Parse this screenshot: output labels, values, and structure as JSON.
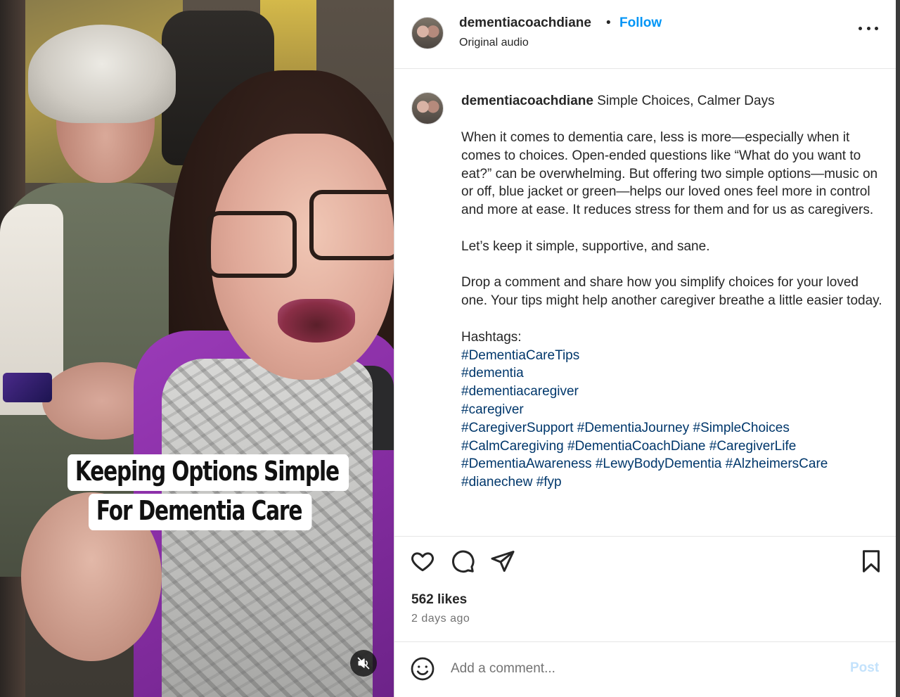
{
  "post": {
    "username": "dementiacoachdiane",
    "separator": "•",
    "follow_label": "Follow",
    "audio_label": "Original audio",
    "more_icon": "more-horizontal-icon"
  },
  "video": {
    "overlay_line1": "Keeping Options Simple",
    "overlay_line2": "For Dementia Care",
    "mute_icon": "speaker-muted-icon"
  },
  "caption": {
    "username": "dementiacoachdiane",
    "title": "Simple Choices, Calmer Days",
    "paragraphs": [
      "When it comes to dementia care, less is more—especially when it comes to choices. Open-ended questions like “What do you want to eat?” can be overwhelming. But offering two simple options—music on or off, blue jacket or green—helps our loved ones feel more in control and more at ease. It reduces stress for them and for us as caregivers.",
      "Let’s keep it simple, supportive, and sane.",
      "Drop a comment and share how you simplify choices for your loved one. Your tips might help another caregiver breathe a little easier today."
    ],
    "hashtags_label": "Hashtags:",
    "hashtag_lines": [
      [
        "#DementiaCareTips"
      ],
      [
        "#dementia"
      ],
      [
        "#dementiacaregiver"
      ],
      [
        "#caregiver"
      ],
      [
        "#CaregiverSupport",
        "#DementiaJourney",
        "#SimpleChoices"
      ],
      [
        "#CalmCaregiving",
        "#DementiaCoachDiane",
        "#CaregiverLife"
      ],
      [
        "#DementiaAwareness",
        "#LewyBodyDementia",
        "#AlzheimersCare"
      ],
      [
        "#dianechew",
        "#fyp"
      ]
    ]
  },
  "actions": {
    "like_icon": "heart-icon",
    "comment_icon": "comment-bubble-icon",
    "share_icon": "paper-plane-icon",
    "save_icon": "bookmark-icon"
  },
  "stats": {
    "likes": "562 likes",
    "posted": "2 days ago"
  },
  "comment": {
    "emoji_icon": "smiley-icon",
    "placeholder": "Add a comment...",
    "post_label": "Post"
  },
  "colors": {
    "accent": "#0095f6",
    "hashtag": "#00376b",
    "post_disabled": "#c3e2fc",
    "muted_text": "#737373"
  }
}
